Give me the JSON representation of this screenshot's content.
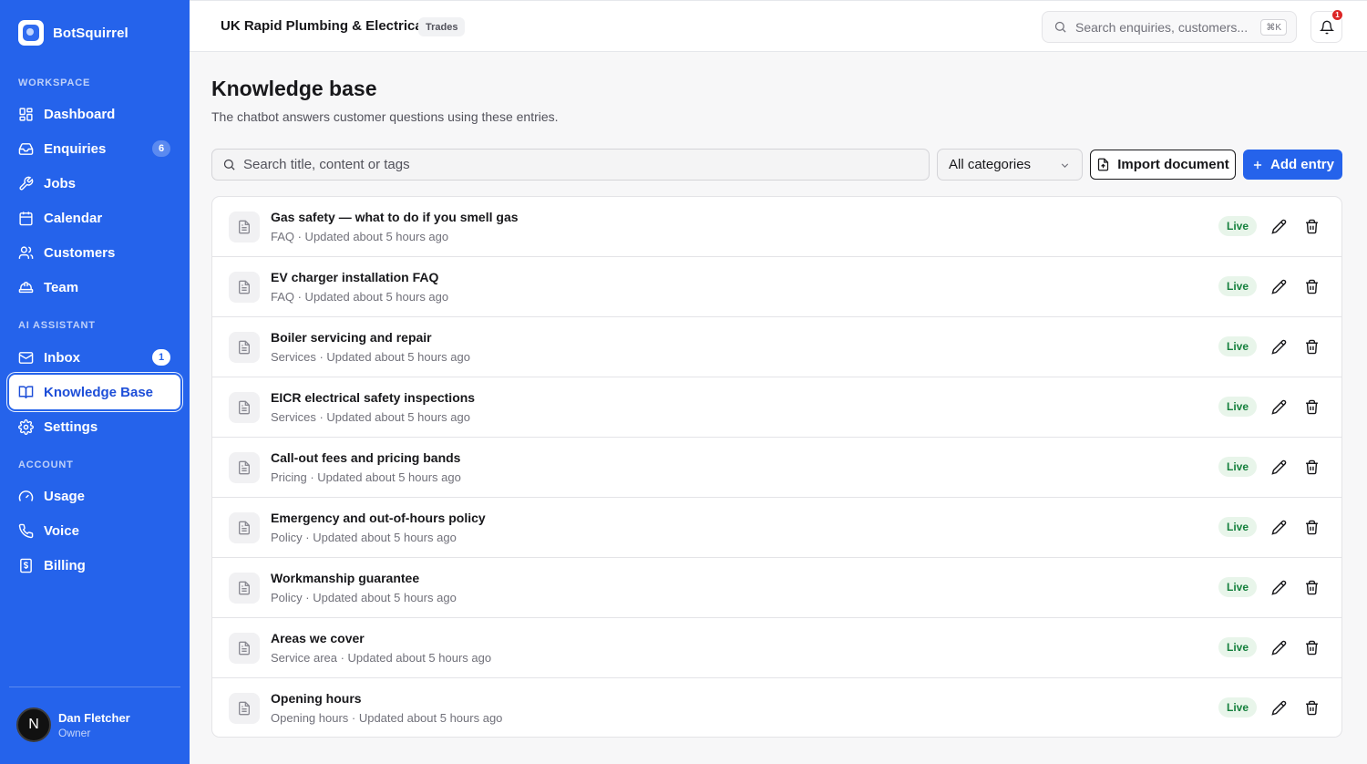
{
  "brand": {
    "name": "BotSquirrel"
  },
  "sidebar": {
    "sections": [
      {
        "label": "Workspace"
      },
      {
        "label": "AI Assistant"
      },
      {
        "label": "Account"
      }
    ],
    "items": [
      {
        "label": "Dashboard",
        "icon": "dashboard-icon"
      },
      {
        "label": "Enquiries",
        "icon": "inbox-tray-icon",
        "badge": "6"
      },
      {
        "label": "Jobs",
        "icon": "wrench-icon"
      },
      {
        "label": "Calendar",
        "icon": "calendar-icon"
      },
      {
        "label": "Customers",
        "icon": "users-icon"
      },
      {
        "label": "Team",
        "icon": "hard-hat-icon"
      },
      {
        "label": "Inbox",
        "icon": "mail-icon",
        "badge": "1"
      },
      {
        "label": "Knowledge Base",
        "icon": "book-icon",
        "active": true
      },
      {
        "label": "Settings",
        "icon": "gear-icon"
      },
      {
        "label": "Usage",
        "icon": "gauge-icon"
      },
      {
        "label": "Voice",
        "icon": "phone-icon"
      },
      {
        "label": "Billing",
        "icon": "receipt-icon"
      }
    ]
  },
  "user": {
    "initial": "N",
    "name": "Dan Fletcher",
    "role": "Owner"
  },
  "topbar": {
    "company": "UK Rapid Plumbing & Electrical",
    "tag": "Trades",
    "search_placeholder": "Search enquiries, customers...",
    "shortcut": "⌘K",
    "notifications": "1"
  },
  "main": {
    "title": "Knowledge base",
    "subtitle": "The chatbot answers customer questions using these entries.",
    "search_placeholder": "Search title, content or tags",
    "category_select": "All categories",
    "import_label": "Import document",
    "add_label": "Add entry"
  },
  "entries": [
    {
      "title": "Gas safety — what to do if you smell gas",
      "meta": "FAQ · Updated about 5 hours ago",
      "status": "Live"
    },
    {
      "title": "EV charger installation FAQ",
      "meta": "FAQ · Updated about 5 hours ago",
      "status": "Live"
    },
    {
      "title": "Boiler servicing and repair",
      "meta": "Services · Updated about 5 hours ago",
      "status": "Live"
    },
    {
      "title": "EICR electrical safety inspections",
      "meta": "Services · Updated about 5 hours ago",
      "status": "Live"
    },
    {
      "title": "Call-out fees and pricing bands",
      "meta": "Pricing · Updated about 5 hours ago",
      "status": "Live"
    },
    {
      "title": "Emergency and out-of-hours policy",
      "meta": "Policy · Updated about 5 hours ago",
      "status": "Live"
    },
    {
      "title": "Workmanship guarantee",
      "meta": "Policy · Updated about 5 hours ago",
      "status": "Live"
    },
    {
      "title": "Areas we cover",
      "meta": "Service area · Updated about 5 hours ago",
      "status": "Live"
    },
    {
      "title": "Opening hours",
      "meta": "Opening hours · Updated about 5 hours ago",
      "status": "Live"
    }
  ],
  "colors": {
    "brand": "#2563eb",
    "live_bg": "#e8f5ea",
    "live_text": "#15803d",
    "alert": "#dc2626"
  }
}
